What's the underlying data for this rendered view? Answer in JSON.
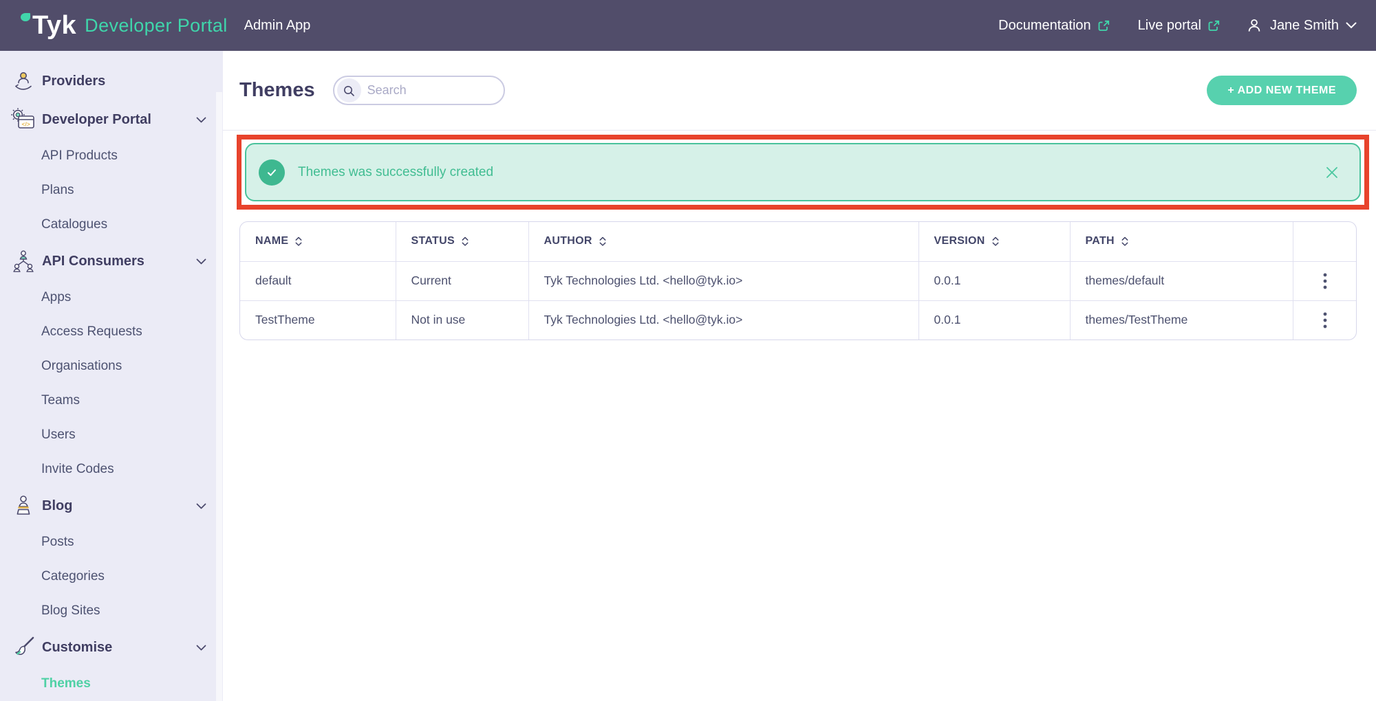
{
  "brand": {
    "logo": "Tyk",
    "product": "Developer Portal",
    "app_label": "Admin App",
    "leaf_icon": "tyk-leaf-icon"
  },
  "header": {
    "links": [
      {
        "id": "documentation",
        "label": "Documentation",
        "icon": "external-link-icon"
      },
      {
        "id": "live-portal",
        "label": "Live portal",
        "icon": "external-link-icon"
      }
    ],
    "user": {
      "name": "Jane Smith",
      "icon": "user-icon",
      "chevron": "chevron-down-icon"
    }
  },
  "sidebar": {
    "items": [
      {
        "id": "providers",
        "label": "Providers",
        "level": "top",
        "icon": "providers-icon",
        "chevron": false,
        "active": false
      },
      {
        "id": "developer-portal",
        "label": "Developer Portal",
        "level": "top",
        "icon": "developer-portal-icon",
        "chevron": true,
        "active": false
      },
      {
        "id": "api-products",
        "label": "API Products",
        "level": "sub",
        "chevron": false,
        "active": false
      },
      {
        "id": "plans",
        "label": "Plans",
        "level": "sub",
        "chevron": false,
        "active": false
      },
      {
        "id": "catalogues",
        "label": "Catalogues",
        "level": "sub",
        "chevron": false,
        "active": false
      },
      {
        "id": "api-consumers",
        "label": "API Consumers",
        "level": "top",
        "icon": "api-consumers-icon",
        "chevron": true,
        "active": false
      },
      {
        "id": "apps",
        "label": "Apps",
        "level": "sub",
        "chevron": false,
        "active": false
      },
      {
        "id": "access-requests",
        "label": "Access Requests",
        "level": "sub",
        "chevron": false,
        "active": false
      },
      {
        "id": "organisations",
        "label": "Organisations",
        "level": "sub",
        "chevron": false,
        "active": false
      },
      {
        "id": "teams",
        "label": "Teams",
        "level": "sub",
        "chevron": false,
        "active": false
      },
      {
        "id": "users",
        "label": "Users",
        "level": "sub",
        "chevron": false,
        "active": false
      },
      {
        "id": "invite-codes",
        "label": "Invite Codes",
        "level": "sub",
        "chevron": false,
        "active": false
      },
      {
        "id": "blog",
        "label": "Blog",
        "level": "top",
        "icon": "blog-icon",
        "chevron": true,
        "active": false
      },
      {
        "id": "posts",
        "label": "Posts",
        "level": "sub",
        "chevron": false,
        "active": false
      },
      {
        "id": "categories",
        "label": "Categories",
        "level": "sub",
        "chevron": false,
        "active": false
      },
      {
        "id": "blog-sites",
        "label": "Blog Sites",
        "level": "sub",
        "chevron": false,
        "active": false
      },
      {
        "id": "customise",
        "label": "Customise",
        "level": "top",
        "icon": "customise-icon",
        "chevron": true,
        "active": false
      },
      {
        "id": "themes",
        "label": "Themes",
        "level": "sub",
        "chevron": false,
        "active": true
      }
    ]
  },
  "page": {
    "title": "Themes",
    "search": {
      "placeholder": "Search",
      "value": "",
      "icon": "search-icon"
    },
    "add_button_label": "+ ADD NEW THEME"
  },
  "notification": {
    "type": "success",
    "message": "Themes was successfully created",
    "check_icon": "check-icon",
    "close_icon": "close-icon",
    "annotated": true
  },
  "table": {
    "columns": [
      "NAME",
      "STATUS",
      "AUTHOR",
      "VERSION",
      "PATH"
    ],
    "sort_icon": "sort-icon",
    "row_action_icon": "kebab-icon",
    "rows": [
      {
        "name": "default",
        "status": "Current",
        "author": "Tyk Technologies Ltd. <hello@tyk.io>",
        "version": "0.0.1",
        "path": "themes/default"
      },
      {
        "name": "TestTheme",
        "status": "Not in use",
        "author": "Tyk Technologies Ltd. <hello@tyk.io>",
        "version": "0.0.1",
        "path": "themes/TestTheme"
      }
    ]
  },
  "colors": {
    "header_bg": "#514d6a",
    "accent_teal": "#41d6ab",
    "button_teal": "#57d1ae",
    "sidebar_bg": "#ebebf6",
    "active_item": "#4fd1a5",
    "banner_bg": "#d6f1e8",
    "banner_border": "#49c29b",
    "banner_text": "#41bd92",
    "annotation_red": "#e8432c",
    "text_navy": "#403e62"
  }
}
